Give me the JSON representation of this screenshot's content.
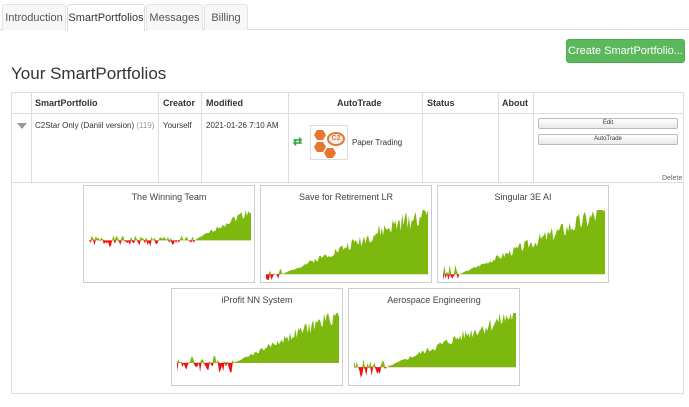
{
  "tabs": [
    {
      "label": "Introduction"
    },
    {
      "label": "SmartPortfolios"
    },
    {
      "label": "Messages"
    },
    {
      "label": "Billing"
    }
  ],
  "create_button": "Create SmartPortfolio...",
  "page_title": "Your SmartPortfolios",
  "table": {
    "headers": [
      "SmartPortfolio",
      "Creator",
      "Modified",
      "AutoTrade",
      "Status",
      "About"
    ],
    "row": {
      "name": "C2Star Only (Daniil version)",
      "count": "(119)",
      "creator": "Yourself",
      "modified": "2021-01-26 7:10 AM",
      "autotrade": "Paper Trading",
      "logo_text": "C2",
      "status": "",
      "about": ""
    },
    "actions": {
      "edit": "Edit",
      "autotrade": "AutoTrade",
      "delete": "Delete"
    }
  },
  "colors": {
    "accent": "#5cb85c",
    "positive": "#7cb80e",
    "negative": "#ee1111",
    "brand": "#e8772e"
  },
  "charts": [
    {
      "title": "The Winning Team"
    },
    {
      "title": "Save for Retirement LR"
    },
    {
      "title": "Singular 3E AI"
    },
    {
      "title": "iProfit NN System"
    },
    {
      "title": "Aerospace Engineering"
    }
  ]
}
